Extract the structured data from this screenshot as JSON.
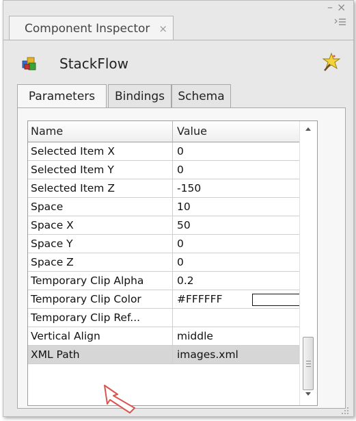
{
  "window": {
    "tab_title": "Component Inspector",
    "tab_close": "×",
    "minimize_glyph": "–",
    "close_glyph": "×"
  },
  "component": {
    "name": "StackFlow",
    "icon": "component-cubes-icon",
    "wizard_icon": "star-wand-icon"
  },
  "tabs": [
    {
      "label": "Parameters",
      "active": true
    },
    {
      "label": "Bindings",
      "active": false
    },
    {
      "label": "Schema",
      "active": false
    }
  ],
  "grid": {
    "headers": {
      "name": "Name",
      "value": "Value"
    },
    "rows": [
      {
        "name": "Selected Item X",
        "value": "0"
      },
      {
        "name": "Selected Item Y",
        "value": "0"
      },
      {
        "name": "Selected Item Z",
        "value": "-150"
      },
      {
        "name": "Space",
        "value": "10"
      },
      {
        "name": "Space X",
        "value": "50"
      },
      {
        "name": "Space Y",
        "value": "0"
      },
      {
        "name": "Space Z",
        "value": "0"
      },
      {
        "name": "Temporary Clip Alpha",
        "value": "0.2"
      },
      {
        "name": "Temporary Clip Color",
        "value": "#FFFFFF",
        "swatch_color": "#FFFFFF"
      },
      {
        "name": "Temporary Clip Ref...",
        "value": ""
      },
      {
        "name": "Vertical Align",
        "value": "middle"
      },
      {
        "name": "XML Path",
        "value": "images.xml",
        "selected": true
      }
    ]
  },
  "colors": {
    "cursor_outline": "#d9534f",
    "selected_row": "#d6d6d6"
  }
}
